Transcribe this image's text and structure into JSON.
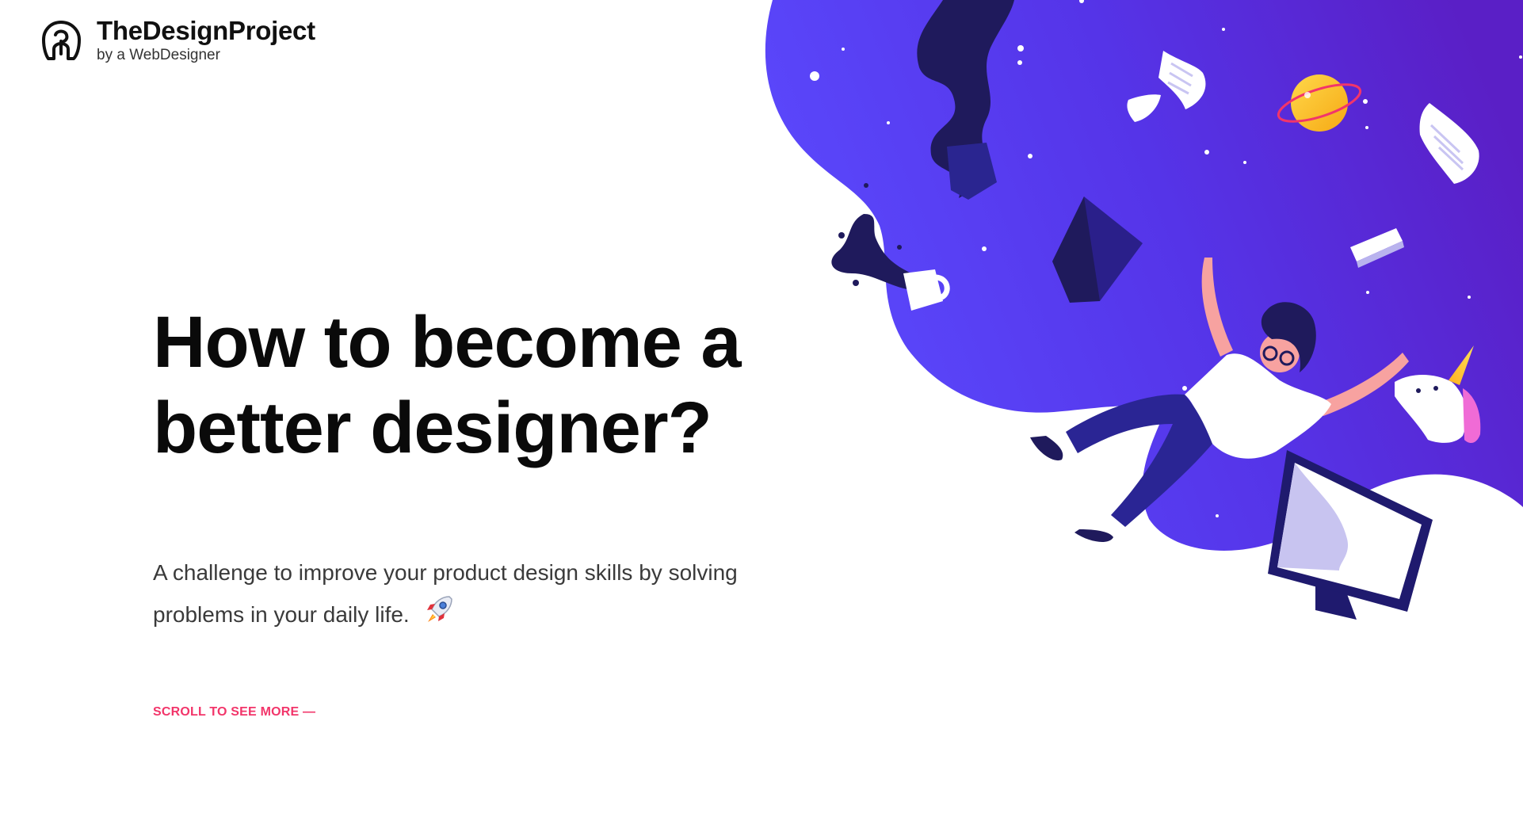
{
  "brand": {
    "name": "TheDesignProject",
    "tagline": "by a WebDesigner"
  },
  "hero": {
    "title_line1": "How to become a",
    "title_line2": "better designer?",
    "subtitle_line1": "A challenge to improve your product design skills by solving",
    "subtitle_line2": "problems in your daily life.",
    "scroll_label": "SCROLL TO SEE MORE —"
  },
  "colors": {
    "accent": "#f2356a",
    "blob_start": "#5b4bff",
    "blob_end": "#5a1fc6",
    "navy": "#1f1a6e",
    "heading": "#0a0a0a"
  },
  "icons": {
    "logo": "elephant-logo-icon",
    "rocket": "rocket-icon"
  },
  "illustration": {
    "subject": "falling-designer-illustration"
  }
}
